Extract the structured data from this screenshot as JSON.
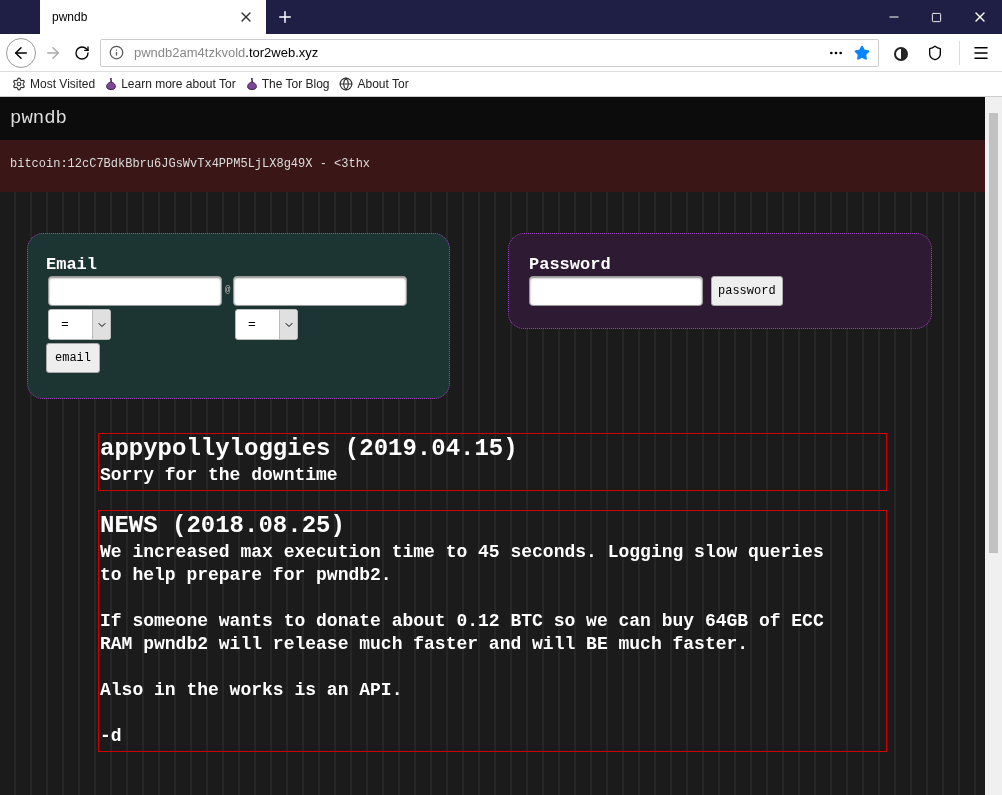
{
  "browser": {
    "tab": {
      "title": "pwndb",
      "selected": true
    },
    "url": {
      "subdomain": "pwndb2am4tzkvold",
      "domain": ".tor2web.xyz"
    },
    "bookmarks": [
      {
        "label": "Most Visited",
        "kind": "gear"
      },
      {
        "label": "Learn more about Tor",
        "kind": "onion"
      },
      {
        "label": "The Tor Blog",
        "kind": "onion"
      },
      {
        "label": "About Tor",
        "kind": "globe"
      }
    ]
  },
  "page": {
    "site_title": "pwndb",
    "banner": "bitcoin:12cC7BdkBbru6JGsWvTx4PPM5LjLX8g49X - <3thx",
    "email_form": {
      "title": "Email",
      "separator": "@",
      "operators": [
        "=",
        "="
      ],
      "button": "email"
    },
    "password_form": {
      "title": "Password",
      "button": "password"
    },
    "news": [
      {
        "title": "appypollyloggies (2019.04.15)",
        "paragraphs": [
          "Sorry for the downtime"
        ]
      },
      {
        "title": "NEWS (2018.08.25)",
        "paragraphs": [
          "We increased max execution time to 45 seconds. Logging slow queries to help prepare for pwndb2.",
          "If someone wants to donate about 0.12 BTC so we can buy 64GB of ECC RAM pwndb2 will release much faster and will BE much faster.",
          "Also in the works is an API.",
          "-d"
        ]
      }
    ]
  }
}
